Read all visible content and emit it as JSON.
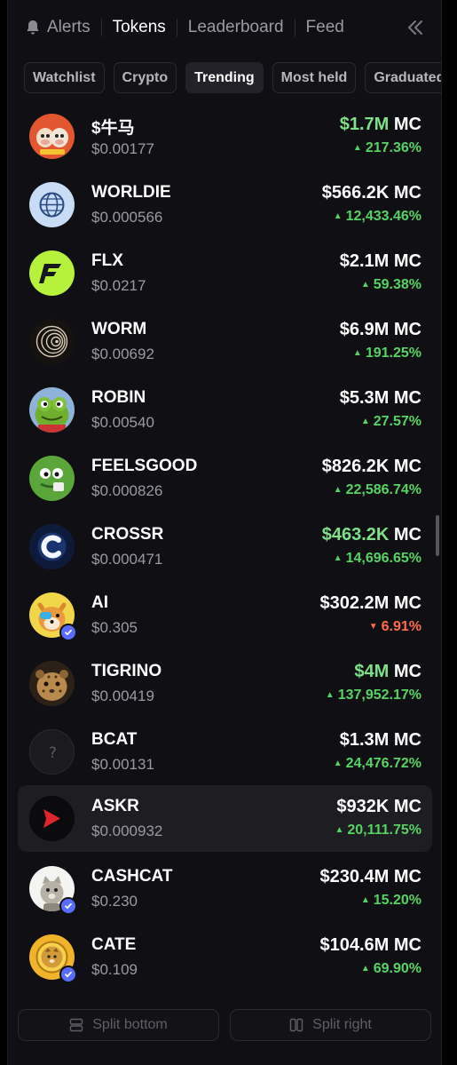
{
  "tabs": [
    {
      "label": "Alerts",
      "active": false,
      "icon": "bell-icon"
    },
    {
      "label": "Tokens",
      "active": true
    },
    {
      "label": "Leaderboard",
      "active": false
    },
    {
      "label": "Feed",
      "active": false
    }
  ],
  "filters": [
    {
      "label": "Watchlist",
      "active": false
    },
    {
      "label": "Crypto",
      "active": false
    },
    {
      "label": "Trending",
      "active": true
    },
    {
      "label": "Most held",
      "active": false
    },
    {
      "label": "Graduated",
      "active": false
    }
  ],
  "tokens": [
    {
      "name": "$牛马",
      "price": "$0.00177",
      "mc_value": "$1.7M",
      "mc_unit": "MC",
      "change": "217.36%",
      "direction": "up",
      "mc_green": true,
      "verified": false
    },
    {
      "name": "WORLDIE",
      "price": "$0.000566",
      "mc_value": "$566.2K",
      "mc_unit": "MC",
      "change": "12,433.46%",
      "direction": "up",
      "mc_green": false,
      "verified": false
    },
    {
      "name": "FLX",
      "price": "$0.0217",
      "mc_value": "$2.1M",
      "mc_unit": "MC",
      "change": "59.38%",
      "direction": "up",
      "mc_green": false,
      "verified": false
    },
    {
      "name": "WORM",
      "price": "$0.00692",
      "mc_value": "$6.9M",
      "mc_unit": "MC",
      "change": "191.25%",
      "direction": "up",
      "mc_green": false,
      "verified": false
    },
    {
      "name": "ROBIN",
      "price": "$0.00540",
      "mc_value": "$5.3M",
      "mc_unit": "MC",
      "change": "27.57%",
      "direction": "up",
      "mc_green": false,
      "verified": false
    },
    {
      "name": "FEELSGOOD",
      "price": "$0.000826",
      "mc_value": "$826.2K",
      "mc_unit": "MC",
      "change": "22,586.74%",
      "direction": "up",
      "mc_green": false,
      "verified": false
    },
    {
      "name": "CROSSR",
      "price": "$0.000471",
      "mc_value": "$463.2K",
      "mc_unit": "MC",
      "change": "14,696.65%",
      "direction": "up",
      "mc_green": true,
      "verified": false
    },
    {
      "name": "AI",
      "price": "$0.305",
      "mc_value": "$302.2M",
      "mc_unit": "MC",
      "change": "6.91%",
      "direction": "down",
      "mc_green": false,
      "verified": true
    },
    {
      "name": "TIGRINO",
      "price": "$0.00419",
      "mc_value": "$4M",
      "mc_unit": "MC",
      "change": "137,952.17%",
      "direction": "up",
      "mc_green": true,
      "verified": false
    },
    {
      "name": "BCAT",
      "price": "$0.00131",
      "mc_value": "$1.3M",
      "mc_unit": "MC",
      "change": "24,476.72%",
      "direction": "up",
      "mc_green": false,
      "verified": false
    },
    {
      "name": "ASKR",
      "price": "$0.000932",
      "mc_value": "$932K",
      "mc_unit": "MC",
      "change": "20,111.75%",
      "direction": "up",
      "mc_green": false,
      "verified": false,
      "highlighted": true
    },
    {
      "name": "CASHCAT",
      "price": "$0.230",
      "mc_value": "$230.4M",
      "mc_unit": "MC",
      "change": "15.20%",
      "direction": "up",
      "mc_green": false,
      "verified": true
    },
    {
      "name": "CATE",
      "price": "$0.109",
      "mc_value": "$104.6M",
      "mc_unit": "MC",
      "change": "69.90%",
      "direction": "up",
      "mc_green": false,
      "verified": true
    }
  ],
  "bottom": {
    "split_bottom": "Split bottom",
    "split_right": "Split right"
  },
  "colors": {
    "up": "#56d364",
    "down": "#ff6b4a",
    "verified": "#5a6cff",
    "background": "#101014"
  }
}
